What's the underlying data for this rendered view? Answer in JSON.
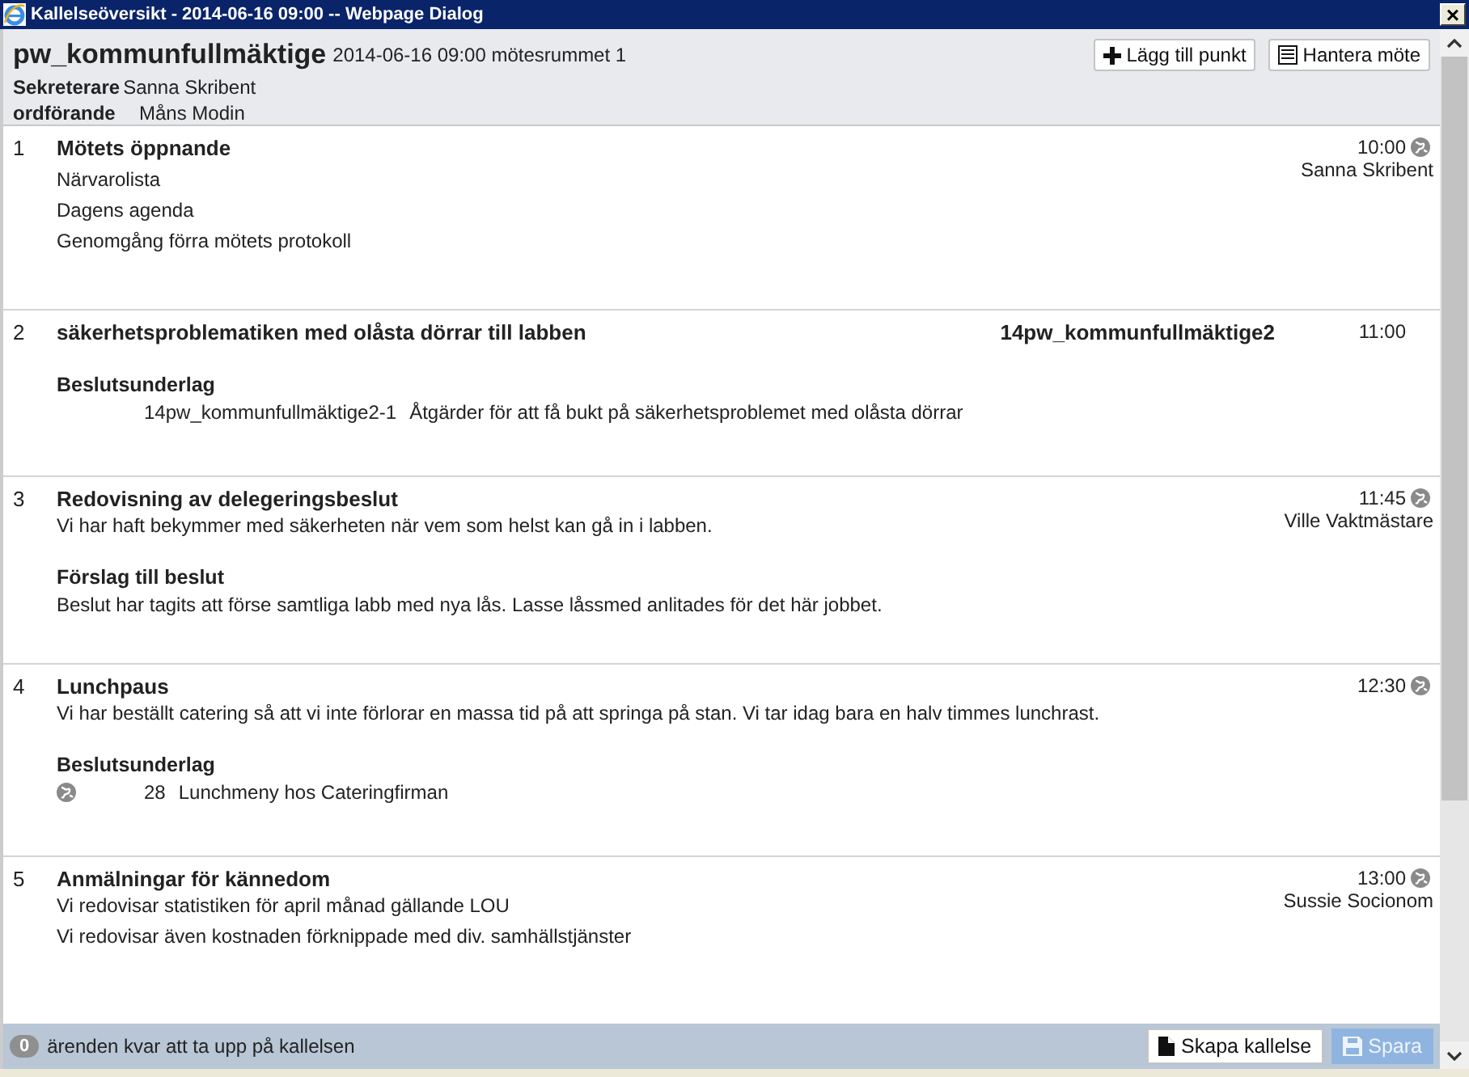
{
  "window": {
    "title": "Kallelseöversikt - 2014-06-16 09:00 -- Webpage Dialog",
    "close": "×"
  },
  "header": {
    "title": "pw_kommunfullmäktige",
    "subtitle": "2014-06-16 09:00 mötesrummet 1",
    "buttons": [
      {
        "kind": "add",
        "label": "Lägg till punkt"
      },
      {
        "kind": "manage",
        "label": "Hantera möte"
      }
    ],
    "roles": [
      {
        "role": "Sekreterare",
        "name": "Sanna Skribent"
      },
      {
        "role": "ordförande",
        "name": "Måns Modin"
      }
    ]
  },
  "items": [
    {
      "number": "1",
      "title": "Mötets öppnande",
      "time": "10:00",
      "globe": true,
      "presenter": "Sanna Skribent",
      "blocks": [
        {
          "kind": "line",
          "text": "Närvarolista"
        },
        {
          "kind": "line",
          "text": "Dagens agenda"
        },
        {
          "kind": "line",
          "text": "Genomgång förra mötets protokoll"
        }
      ]
    },
    {
      "number": "2",
      "title": "säkerhetsproblematiken med olåsta dörrar till labben",
      "case": "14pw_kommunfullmäktige2",
      "time": "11:00",
      "globe": false,
      "blocks": [
        {
          "kind": "attachments",
          "heading": "Beslutsunderlag",
          "attachments": [
            {
              "code": "14pw_kommunfullmäktige2-1",
              "title": "Åtgärder för att få bukt på säkerhetsproblemet med olåsta dörrar",
              "globe": false
            }
          ]
        }
      ]
    },
    {
      "number": "3",
      "title": "Redovisning av delegeringsbeslut",
      "time": "11:45",
      "globe": true,
      "presenter": "Ville Vaktmästare",
      "blocks": [
        {
          "kind": "paragraph",
          "text": "Vi har haft bekymmer med säkerheten när vem som helst kan gå in i labben."
        },
        {
          "kind": "section",
          "heading": "Förslag till beslut",
          "text": "Beslut har tagits att förse samtliga labb med nya lås. Lasse låssmed anlitades för det här jobbet."
        }
      ]
    },
    {
      "number": "4",
      "title": "Lunchpaus",
      "time": "12:30",
      "globe": true,
      "blocks": [
        {
          "kind": "paragraph",
          "text": "Vi har beställt catering så att vi inte förlorar en massa tid på att springa på stan. Vi tar idag bara en halv timmes lunchrast."
        },
        {
          "kind": "attachments",
          "heading": "Beslutsunderlag",
          "attachments": [
            {
              "code": "28",
              "title": "Lunchmeny hos Cateringfirman",
              "globe": true
            }
          ]
        }
      ]
    },
    {
      "number": "5",
      "title": "Anmälningar för kännedom",
      "time": "13:00",
      "globe": true,
      "presenter": "Sussie Socionom",
      "blocks": [
        {
          "kind": "paragraph",
          "text": "Vi redovisar statistiken för april månad gällande LOU"
        },
        {
          "kind": "line",
          "text": "Vi redovisar även kostnaden förknippade med div. samhällstjänster"
        }
      ]
    }
  ],
  "footer": {
    "count": "0",
    "text": "ärenden kvar att ta upp på kallelsen",
    "buttons": [
      {
        "kind": "create",
        "label": "Skapa kallelse",
        "disabled": false
      },
      {
        "kind": "save",
        "label": "Spara",
        "disabled": true
      }
    ]
  }
}
